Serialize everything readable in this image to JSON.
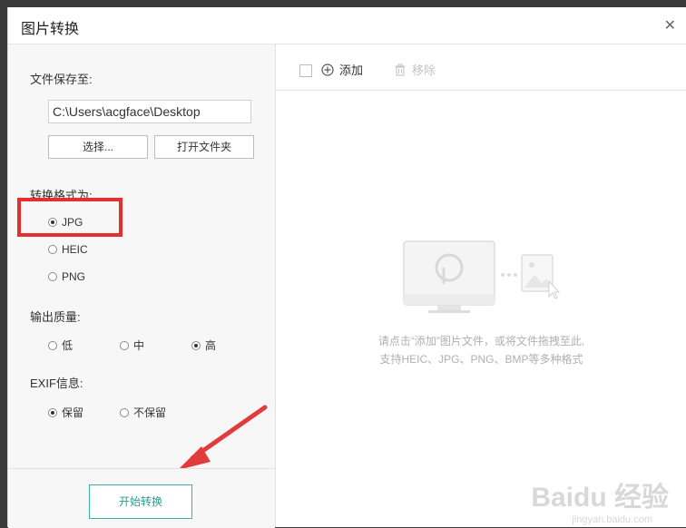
{
  "dialog": {
    "title": "图片转换",
    "close_icon": "close-icon"
  },
  "left": {
    "save_label": "文件保存至:",
    "path_value": "C:\\Users\\acgface\\Desktop",
    "choose_button": "选择...",
    "open_folder_button": "打开文件夹",
    "format_label": "转换格式为:",
    "formats": [
      "JPG",
      "HEIC",
      "PNG"
    ],
    "format_selected": "JPG",
    "quality_label": "输出质量:",
    "qualities": [
      "低",
      "中",
      "高"
    ],
    "quality_selected": "高",
    "exif_label": "EXIF信息:",
    "exif_options": [
      "保留",
      "不保留"
    ],
    "exif_selected": "保留",
    "start_button": "开始转换"
  },
  "right": {
    "add_label": "添加",
    "remove_label": "移除",
    "empty_line1": "请点击“添加”图片文件，或将文件拖拽至此,",
    "empty_line2": "支持HEIC、JPG、PNG、BMP等多种格式"
  },
  "watermark": {
    "main": "Baidu 经验",
    "sub": "jingyan.baidu.com"
  },
  "colors": {
    "accent": "#2a9d8f",
    "highlight": "#e62e2e",
    "arrow": "#e23b3b"
  }
}
